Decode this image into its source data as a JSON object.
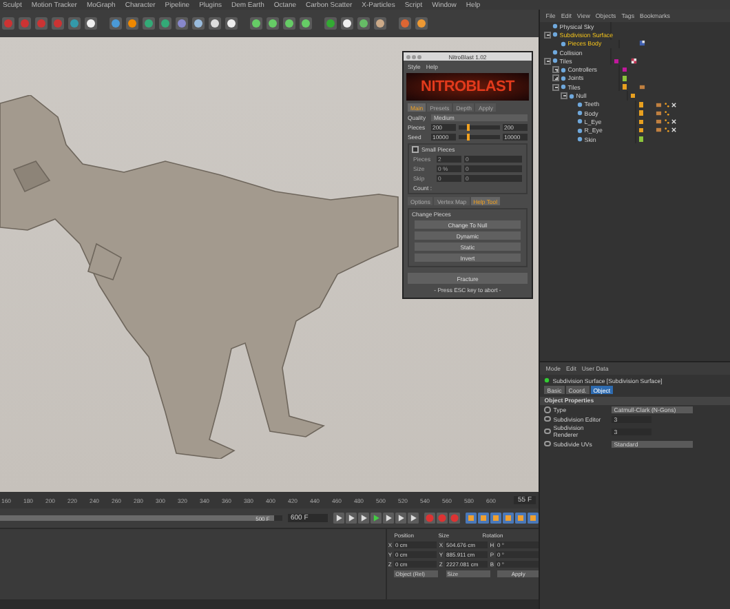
{
  "menu_bar": [
    "Sculpt",
    "Motion Tracker",
    "MoGraph",
    "Character",
    "Pipeline",
    "Plugins",
    "Dem Earth",
    "Octane",
    "Carbon Scatter",
    "X-Particles",
    "Script",
    "Window",
    "Help"
  ],
  "object_manager": {
    "menu": [
      "File",
      "Edit",
      "View",
      "Objects",
      "Tags",
      "Bookmarks"
    ],
    "objects": [
      {
        "name": "Physical Sky",
        "selected": false
      },
      {
        "name": "Subdivision Surface",
        "selected": true,
        "expanded": true,
        "children": [
          {
            "name": "Pieces Body",
            "selected": true,
            "tags": [
              {
                "kind": "texture"
              }
            ]
          }
        ]
      },
      {
        "name": "Collision",
        "selected": false
      },
      {
        "name": "Tiles",
        "selected": false,
        "color": "#c0189c",
        "expanded": true,
        "tags": [
          {
            "kind": "checker"
          }
        ],
        "children": [
          {
            "name": "Controllers",
            "selected": false,
            "color": "#c0189c",
            "expanded": false
          },
          {
            "name": "Joints",
            "selected": false,
            "color": "#8cc43c",
            "expanded": false
          },
          {
            "name": "Tiles",
            "selected": false,
            "color": "#e8a020",
            "expanded": true,
            "tags": [
              {
                "kind": "material"
              }
            ],
            "children": [
              {
                "name": "Null",
                "selected": false,
                "color": "#e8a020",
                "expanded": true,
                "children": [
                  {
                    "name": "Teeth",
                    "selected": false,
                    "color": "#e8a020",
                    "tags": [
                      {
                        "kind": "material"
                      },
                      {
                        "kind": "weight"
                      },
                      {
                        "kind": "cross"
                      }
                    ]
                  },
                  {
                    "name": "Body",
                    "selected": false,
                    "color": "#e8a020",
                    "tags": [
                      {
                        "kind": "material"
                      },
                      {
                        "kind": "weight"
                      }
                    ]
                  },
                  {
                    "name": "L_Eye",
                    "selected": false,
                    "color": "#e8a020",
                    "tags": [
                      {
                        "kind": "material"
                      },
                      {
                        "kind": "weight"
                      },
                      {
                        "kind": "cross"
                      }
                    ]
                  },
                  {
                    "name": "R_Eye",
                    "selected": false,
                    "color": "#e8a020",
                    "tags": [
                      {
                        "kind": "material"
                      },
                      {
                        "kind": "weight"
                      },
                      {
                        "kind": "cross"
                      }
                    ]
                  },
                  {
                    "name": "Skin",
                    "selected": false,
                    "color": "#8cc43c"
                  }
                ]
              }
            ]
          }
        ]
      }
    ]
  },
  "dialog": {
    "title": "NitroBlast 1.02",
    "menu": [
      "Style",
      "Help"
    ],
    "logo": "NITROBLAST",
    "tabs": [
      {
        "label": "Main",
        "selected": true
      },
      {
        "label": "Presets",
        "selected": false
      },
      {
        "label": "Depth",
        "selected": false
      },
      {
        "label": "Apply",
        "selected": false
      }
    ],
    "quality": {
      "label": "Quality",
      "value": "Medium"
    },
    "sliders": [
      {
        "label": "Pieces",
        "value": "200",
        "level": 0.2,
        "reading": "200"
      },
      {
        "label": "Seed",
        "value": "10000",
        "level": 0.2,
        "reading": "10000"
      }
    ],
    "small_pieces": {
      "label": "Small Pieces",
      "checked": false,
      "rows": [
        {
          "label": "Pieces",
          "value": "2",
          "reading": "0",
          "disabled": true
        },
        {
          "label": "Size",
          "value": "0 %",
          "reading": "0",
          "disabled": true
        },
        {
          "label": "Skip",
          "value": "0",
          "reading": "0",
          "disabled": true
        }
      ],
      "count": "Count :"
    },
    "lower_tabs": [
      {
        "label": "Options",
        "selected": false
      },
      {
        "label": "Vertex Map",
        "selected": false
      },
      {
        "label": "Help Tool",
        "selected": true
      }
    ],
    "group": {
      "title": "Change Pieces",
      "buttons": [
        "Change To Null",
        "Dynamic",
        "Static",
        "Invert"
      ]
    },
    "fracture": "Fracture",
    "hint": "- Press ESC key to abort -"
  },
  "timeline": {
    "ticks": [
      "160",
      "180",
      "200",
      "220",
      "240",
      "260",
      "280",
      "300",
      "320",
      "340",
      "360",
      "380",
      "400",
      "420",
      "440",
      "460",
      "480",
      "500",
      "520",
      "540",
      "560",
      "580",
      "600"
    ],
    "current_frame": "55 F"
  },
  "transport": {
    "range_end": "500 F",
    "level": 0.97,
    "end_frame": "600 F"
  },
  "coordinates": {
    "columns": [
      "Position",
      "Size",
      "Rotation"
    ],
    "rows": [
      {
        "axis": "X",
        "position": "0 cm",
        "size_axis": "X",
        "size": "504.676 cm",
        "rot_axis": "H",
        "rotation": "0 °"
      },
      {
        "axis": "Y",
        "position": "0 cm",
        "size_axis": "Y",
        "size": "885.911 cm",
        "rot_axis": "P",
        "rotation": "0 °"
      },
      {
        "axis": "Z",
        "position": "0 cm",
        "size_axis": "Z",
        "size": "2227.081 cm",
        "rot_axis": "B",
        "rotation": "0 °"
      }
    ],
    "mode": "Object (Rel)",
    "size_mode": "Size",
    "apply": "Apply"
  },
  "attributes": {
    "menu": [
      "Mode",
      "Edit",
      "User Data"
    ],
    "title": "Subdivision Surface [Subdivision Surface]",
    "tabs": [
      {
        "label": "Basic",
        "selected": false
      },
      {
        "label": "Coord.",
        "selected": false
      },
      {
        "label": "Object",
        "selected": true
      }
    ],
    "section": "Object Properties",
    "properties": [
      {
        "label": "Type",
        "kind": "dropdown",
        "value": "Catmull-Clark (N-Gons)"
      },
      {
        "label": "Subdivision Editor",
        "kind": "number",
        "value": "3"
      },
      {
        "label": "Subdivision Renderer",
        "kind": "number",
        "value": "3"
      },
      {
        "label": "Subdivide UVs",
        "kind": "dropdown",
        "value": "Standard"
      }
    ]
  }
}
